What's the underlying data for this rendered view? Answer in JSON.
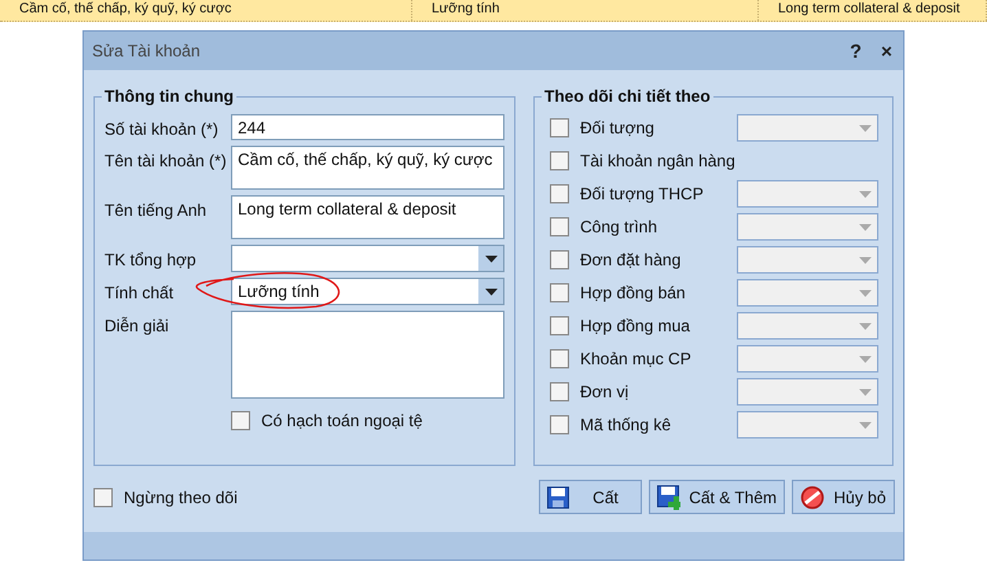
{
  "background_row": [
    "Cầm cố, thế chấp, ký quỹ, ký cược",
    "Lưỡng tính",
    "Long term collateral & deposit"
  ],
  "dialog": {
    "title": "Sửa Tài khoản",
    "help": "?",
    "close": "×"
  },
  "general_group": {
    "title": "Thông tin chung",
    "fields": [
      {
        "label": "Số tài khoản (*)",
        "value": "244",
        "kind": "text",
        "annotated": false
      },
      {
        "label": "Tên tài khoản (*)",
        "value": "Cầm cố, thế chấp, ký quỹ, ký cược",
        "kind": "textarea",
        "annotated": false
      },
      {
        "label": "Tên tiếng Anh",
        "value": "Long term collateral & deposit",
        "kind": "textarea",
        "annotated": false
      },
      {
        "label": "TK tổng hợp",
        "kind": "combo",
        "annotated": false
      },
      {
        "label": "Tính chất",
        "value": "Lưỡng tính",
        "kind": "combo",
        "annotated": true
      },
      {
        "label": "Diễn giải",
        "kind": "memo",
        "annotated": false
      }
    ],
    "foreign_currency": {
      "label": "Có hạch toán ngoại tệ",
      "checked": false
    }
  },
  "tracking_group": {
    "title": "Theo dõi chi tiết theo",
    "items": [
      {
        "label": "Đối tượng",
        "checked": false,
        "kind": "combo"
      },
      {
        "label": "Tài khoản ngân hàng",
        "checked": false,
        "kind": "plain"
      },
      {
        "label": "Đối tượng THCP",
        "checked": false,
        "kind": "combo"
      },
      {
        "label": "Công trình",
        "checked": false,
        "kind": "combo"
      },
      {
        "label": "Đơn đặt hàng",
        "checked": false,
        "kind": "combo"
      },
      {
        "label": "Hợp đồng bán",
        "checked": false,
        "kind": "combo"
      },
      {
        "label": "Hợp đồng mua",
        "checked": false,
        "kind": "combo"
      },
      {
        "label": "Khoản mục CP",
        "checked": false,
        "kind": "combo"
      },
      {
        "label": "Đơn vị",
        "checked": false,
        "kind": "combo"
      },
      {
        "label": "Mã thống kê",
        "checked": false,
        "kind": "combo"
      }
    ]
  },
  "stop_tracking": {
    "label": "Ngừng theo dõi",
    "checked": false
  },
  "buttons": [
    {
      "label": "Cất",
      "kind": "save"
    },
    {
      "label": "Cất & Thêm",
      "kind": "save_add"
    },
    {
      "label": "Hủy bỏ",
      "kind": "cancel"
    }
  ]
}
